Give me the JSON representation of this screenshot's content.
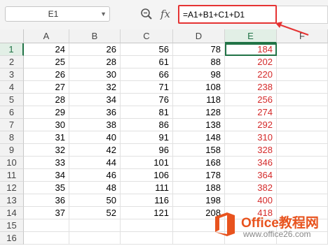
{
  "formula_bar": {
    "name_box": "E1",
    "fx_label": "fx",
    "formula": "=A1+B1+C1+D1"
  },
  "columns": [
    "A",
    "B",
    "C",
    "D",
    "E",
    "F"
  ],
  "rows": [
    {
      "num": "1",
      "cells": [
        "24",
        "26",
        "56",
        "78",
        "184"
      ]
    },
    {
      "num": "2",
      "cells": [
        "25",
        "28",
        "61",
        "88",
        "202"
      ]
    },
    {
      "num": "3",
      "cells": [
        "26",
        "30",
        "66",
        "98",
        "220"
      ]
    },
    {
      "num": "4",
      "cells": [
        "27",
        "32",
        "71",
        "108",
        "238"
      ]
    },
    {
      "num": "5",
      "cells": [
        "28",
        "34",
        "76",
        "118",
        "256"
      ]
    },
    {
      "num": "6",
      "cells": [
        "29",
        "36",
        "81",
        "128",
        "274"
      ]
    },
    {
      "num": "7",
      "cells": [
        "30",
        "38",
        "86",
        "138",
        "292"
      ]
    },
    {
      "num": "8",
      "cells": [
        "31",
        "40",
        "91",
        "148",
        "310"
      ]
    },
    {
      "num": "9",
      "cells": [
        "32",
        "42",
        "96",
        "158",
        "328"
      ]
    },
    {
      "num": "10",
      "cells": [
        "33",
        "44",
        "101",
        "168",
        "346"
      ]
    },
    {
      "num": "11",
      "cells": [
        "34",
        "46",
        "106",
        "178",
        "364"
      ]
    },
    {
      "num": "12",
      "cells": [
        "35",
        "48",
        "111",
        "188",
        "382"
      ]
    },
    {
      "num": "13",
      "cells": [
        "36",
        "50",
        "116",
        "198",
        "400"
      ]
    },
    {
      "num": "14",
      "cells": [
        "37",
        "52",
        "121",
        "208",
        "418"
      ]
    },
    {
      "num": "15",
      "cells": [
        "",
        "",
        "",
        "",
        ""
      ]
    },
    {
      "num": "16",
      "cells": [
        "",
        "",
        "",
        "",
        ""
      ]
    }
  ],
  "active_cell": {
    "col": "E",
    "row": "1"
  },
  "colors": {
    "result_text": "#d42a2a",
    "selection": "#217346",
    "highlight": "#e53333",
    "logo": "#e8531e"
  },
  "watermark": {
    "title": "Office教程网",
    "subtitle": "www.office26.com"
  }
}
